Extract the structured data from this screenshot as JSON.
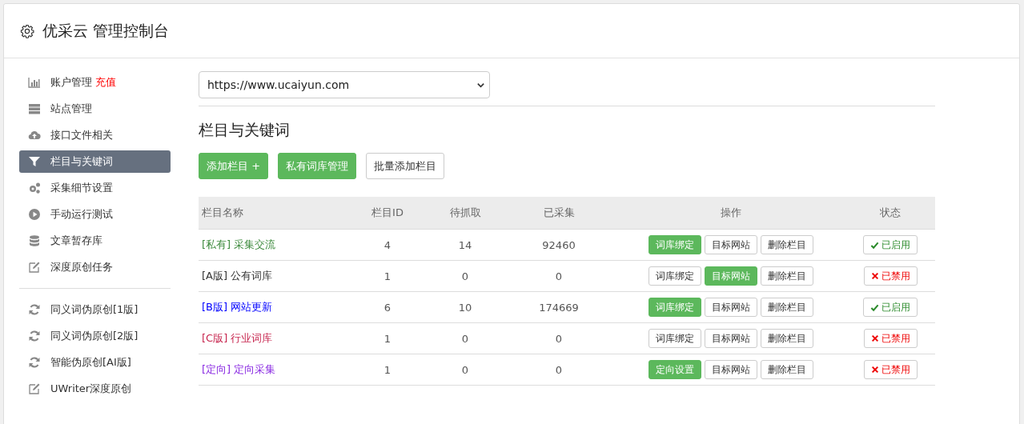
{
  "header": {
    "title": "优采云 管理控制台"
  },
  "sidebar": {
    "groups": [
      {
        "items": [
          {
            "label": "账户管理",
            "badge": "充值",
            "selected": false
          },
          {
            "label": "站点管理",
            "selected": false
          },
          {
            "label": "接口文件相关",
            "selected": false
          },
          {
            "label": "栏目与关键词",
            "selected": true
          },
          {
            "label": "采集细节设置",
            "selected": false
          },
          {
            "label": "手动运行测试",
            "selected": false
          },
          {
            "label": "文章暂存库",
            "selected": false
          },
          {
            "label": "深度原创任务",
            "selected": false
          }
        ]
      },
      {
        "items": [
          {
            "label": "同义词伪原创[1版]",
            "selected": false
          },
          {
            "label": "同义词伪原创[2版]",
            "selected": false
          },
          {
            "label": "智能伪原创[AI版]",
            "selected": false
          },
          {
            "label": "UWriter深度原创",
            "selected": false
          }
        ]
      }
    ]
  },
  "site_select": {
    "value": "https://www.ucaiyun.com"
  },
  "section_title": "栏目与关键词",
  "toolbar": [
    {
      "label": "添加栏目 +",
      "primary": true
    },
    {
      "label": "私有词库管理",
      "primary": true
    },
    {
      "label": "批量添加栏目",
      "primary": false
    }
  ],
  "table": {
    "columns": [
      "栏目名称",
      "栏目ID",
      "待抓取",
      "已采集",
      "操作",
      "状态"
    ],
    "rows": [
      {
        "tag": "[私有]",
        "name": "采集交流",
        "color": "#3c8a3c",
        "id": "4",
        "pending": "14",
        "collected": "92460",
        "actions": [
          {
            "label": "词库绑定",
            "primary": true
          },
          {
            "label": "目标网站",
            "primary": false
          },
          {
            "label": "删除栏目",
            "primary": false
          }
        ],
        "status": "已启用",
        "enabled": true
      },
      {
        "tag": "[A版]",
        "name": "公有词库",
        "color": "#333333",
        "id": "1",
        "pending": "0",
        "collected": "0",
        "actions": [
          {
            "label": "词库绑定",
            "primary": false
          },
          {
            "label": "目标网站",
            "primary": true
          },
          {
            "label": "删除栏目",
            "primary": false
          }
        ],
        "status": "已禁用",
        "enabled": false
      },
      {
        "tag": "[B版]",
        "name": "网站更新",
        "color": "#0000ff",
        "id": "6",
        "pending": "10",
        "collected": "174669",
        "actions": [
          {
            "label": "词库绑定",
            "primary": true
          },
          {
            "label": "目标网站",
            "primary": false
          },
          {
            "label": "删除栏目",
            "primary": false
          }
        ],
        "status": "已启用",
        "enabled": true
      },
      {
        "tag": "[C版]",
        "name": "行业词库",
        "color": "#c7254e",
        "id": "1",
        "pending": "0",
        "collected": "0",
        "actions": [
          {
            "label": "词库绑定",
            "primary": false
          },
          {
            "label": "目标网站",
            "primary": false
          },
          {
            "label": "删除栏目",
            "primary": false
          }
        ],
        "status": "已禁用",
        "enabled": false
      },
      {
        "tag": "[定向]",
        "name": "定向采集",
        "color": "#8a2be2",
        "id": "1",
        "pending": "0",
        "collected": "0",
        "actions": [
          {
            "label": "定向设置",
            "primary": true
          },
          {
            "label": "目标网站",
            "primary": false
          },
          {
            "label": "删除栏目",
            "primary": false
          }
        ],
        "status": "已禁用",
        "enabled": false
      }
    ]
  }
}
